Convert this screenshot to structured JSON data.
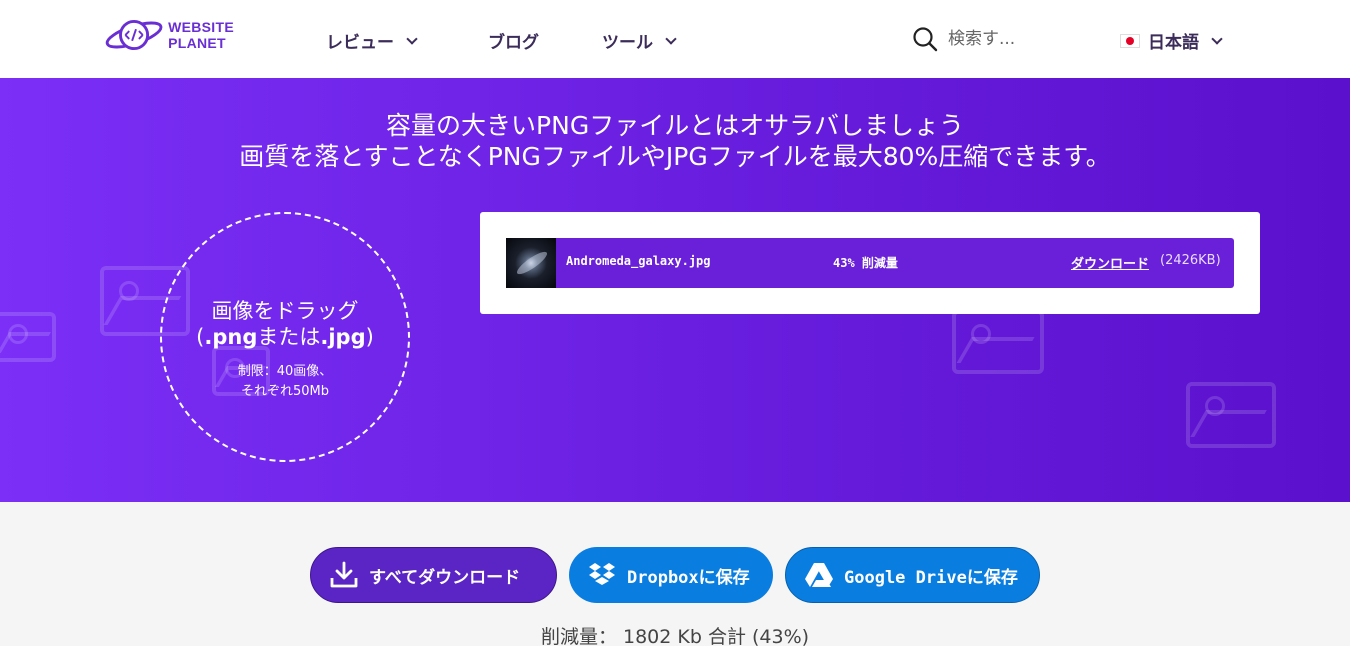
{
  "header": {
    "logo_line1": "WEBSITE",
    "logo_line2": "PLANET",
    "nav": [
      {
        "label": "レビュー",
        "has_dropdown": true
      },
      {
        "label": "ブログ",
        "has_dropdown": false
      },
      {
        "label": "ツール",
        "has_dropdown": true
      }
    ],
    "search_placeholder": "検索す...",
    "language": "日本語"
  },
  "hero": {
    "title_line1": "容量の大きいPNGファイルとはオサラバしましょう",
    "title_line2": "画質を落とすことなくPNGファイルやJPGファイルを最大80%圧縮できます。"
  },
  "dropzone": {
    "title": "画像をドラッグ",
    "formats_open": "(",
    "format1": ".png",
    "formats_or": "または",
    "format2": ".jpg",
    "formats_close": ")",
    "limit_line1": "制限：40画像、",
    "limit_line2": "それぞれ50Mb"
  },
  "files": [
    {
      "name": "Andromeda_galaxy.jpg",
      "ratio": "43% 削減量",
      "download_label": "ダウンロード",
      "size": "(2426KB)"
    }
  ],
  "actions": {
    "download_all": "すべてダウンロード",
    "dropbox": "Dropboxに保存",
    "drive": "Google Driveに保存"
  },
  "summary": {
    "text": "削減量： 1802 Kb 合計 (43%)"
  },
  "colors": {
    "brand": "#6a2fd3",
    "hero_start": "#7b2ff7",
    "hero_end": "#5a10cc",
    "file_row": "#6a1fd8",
    "button_blue": "#0a7ee0",
    "button_purple": "#5b24c4"
  }
}
